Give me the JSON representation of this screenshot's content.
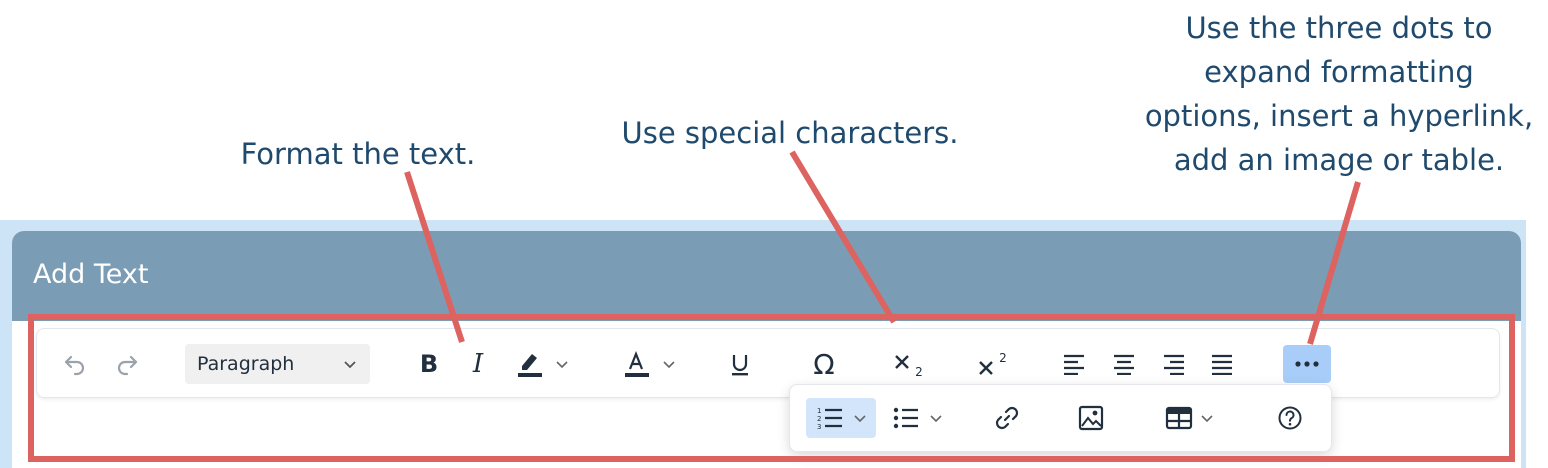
{
  "callouts": {
    "format": "Format the text.",
    "special": "Use special characters.",
    "dots_line1": "Use the three dots to",
    "dots_line2": "expand formatting",
    "dots_line3": "options, insert a hyperlink,",
    "dots_line4": "add an image or table."
  },
  "panel": {
    "title": "Add Text"
  },
  "toolbar": {
    "block_format": "Paragraph",
    "subscript_digit": "2",
    "superscript_digit": "2"
  },
  "icons": [
    "undo-icon",
    "redo-icon",
    "chevron-down-icon",
    "bold-icon",
    "italic-icon",
    "highlight-icon",
    "text-color-icon",
    "underline-icon",
    "omega-icon",
    "subscript-icon",
    "superscript-icon",
    "align-left-icon",
    "align-center-icon",
    "align-right-icon",
    "justify-icon",
    "more-icon",
    "numbered-list-icon",
    "bullet-list-icon",
    "link-icon",
    "image-icon",
    "table-icon",
    "help-icon"
  ],
  "colors": {
    "callout_text": "#1f4a6d",
    "highlight_box": "#dd6360",
    "panel_header": "#7a9cb4",
    "panel_outer": "#cde3f6",
    "active_button": "#a8cdf8"
  }
}
